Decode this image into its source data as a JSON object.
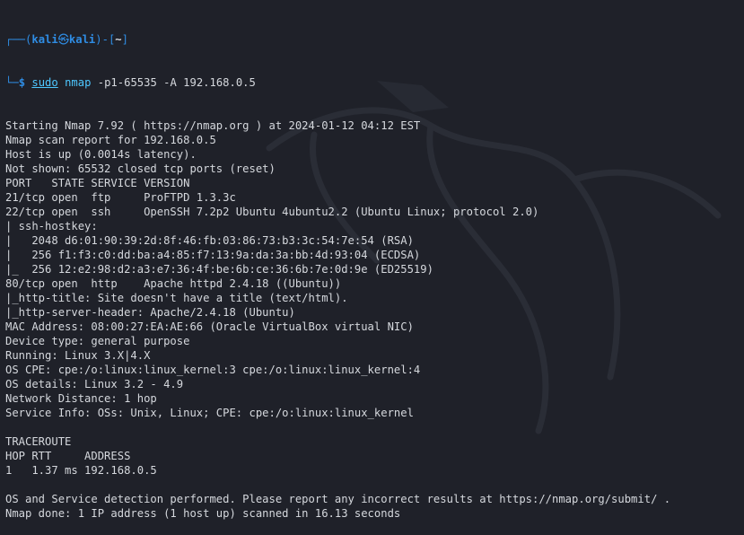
{
  "prompt": {
    "top_left": "┌──(",
    "user": "kali",
    "at": "㉿",
    "host": "kali",
    "mid": ")-[",
    "dir": "~",
    "end": "]",
    "bottom_left": "└─",
    "dollar": "$ "
  },
  "command": {
    "sudo": "sudo",
    "program": " nmap",
    "flags": " -p1-65535 -A",
    "target": " 192.168.0.5"
  },
  "output": [
    "Starting Nmap 7.92 ( https://nmap.org ) at 2024-01-12 04:12 EST",
    "Nmap scan report for 192.168.0.5",
    "Host is up (0.0014s latency).",
    "Not shown: 65532 closed tcp ports (reset)",
    "PORT   STATE SERVICE VERSION",
    "21/tcp open  ftp     ProFTPD 1.3.3c",
    "22/tcp open  ssh     OpenSSH 7.2p2 Ubuntu 4ubuntu2.2 (Ubuntu Linux; protocol 2.0)",
    "| ssh-hostkey: ",
    "|   2048 d6:01:90:39:2d:8f:46:fb:03:86:73:b3:3c:54:7e:54 (RSA)",
    "|   256 f1:f3:c0:dd:ba:a4:85:f7:13:9a:da:3a:bb:4d:93:04 (ECDSA)",
    "|_  256 12:e2:98:d2:a3:e7:36:4f:be:6b:ce:36:6b:7e:0d:9e (ED25519)",
    "80/tcp open  http    Apache httpd 2.4.18 ((Ubuntu))",
    "|_http-title: Site doesn't have a title (text/html).",
    "|_http-server-header: Apache/2.4.18 (Ubuntu)",
    "MAC Address: 08:00:27:EA:AE:66 (Oracle VirtualBox virtual NIC)",
    "Device type: general purpose",
    "Running: Linux 3.X|4.X",
    "OS CPE: cpe:/o:linux:linux_kernel:3 cpe:/o:linux:linux_kernel:4",
    "OS details: Linux 3.2 - 4.9",
    "Network Distance: 1 hop",
    "Service Info: OSs: Unix, Linux; CPE: cpe:/o:linux:linux_kernel",
    "",
    "TRACEROUTE",
    "HOP RTT     ADDRESS",
    "1   1.37 ms 192.168.0.5",
    "",
    "OS and Service detection performed. Please report any incorrect results at https://nmap.org/submit/ .",
    "Nmap done: 1 IP address (1 host up) scanned in 16.13 seconds"
  ],
  "colors": {
    "background": "#1f2129",
    "prompt_blue": "#2f8de4",
    "command_cyan": "#4ec7ff",
    "text": "#d5d8dd"
  }
}
